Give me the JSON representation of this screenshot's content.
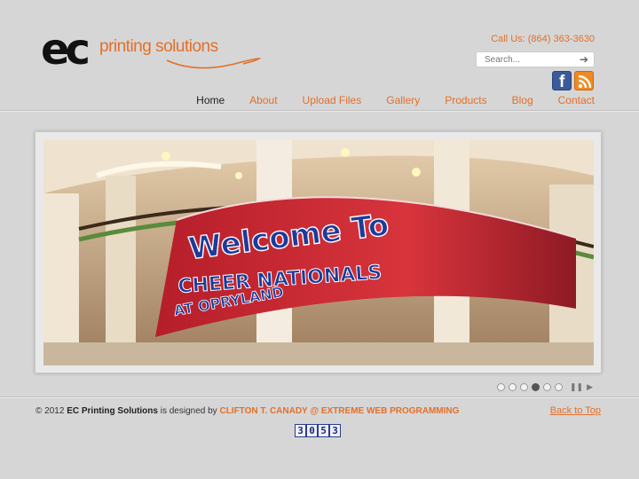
{
  "header": {
    "logo_mark": "ec",
    "logo_text": "printing solutions",
    "phone": "Call Us: (864) 363-3630",
    "search": {
      "placeholder": "Search..."
    },
    "social": [
      {
        "name": "facebook",
        "icon": "facebook-icon",
        "glyph": "f",
        "color": "#3b5a9a"
      },
      {
        "name": "rss",
        "icon": "rss-icon",
        "color": "#f08a20"
      }
    ]
  },
  "nav": {
    "items": [
      {
        "label": "Home",
        "active": true
      },
      {
        "label": "About"
      },
      {
        "label": "Upload Files"
      },
      {
        "label": "Gallery"
      },
      {
        "label": "Products"
      },
      {
        "label": "Blog"
      },
      {
        "label": "Contact"
      }
    ]
  },
  "slider": {
    "banner_line1": "Welcome To",
    "banner_line2": "CHEER NATIONALS",
    "banner_line3": "AT OPRYLAND",
    "dots": 6,
    "active_dot": 4,
    "controls": {
      "pause": "❚❚",
      "play": "▶"
    }
  },
  "footer": {
    "copyright_prefix": "© 2012",
    "company": "EC Printing Solutions",
    "designed_by": "is designed by",
    "designer": "CLIFTON T. CANADY @ EXTREME WEB PROGRAMMING",
    "back_to_top": "Back to Top",
    "counter": [
      "3",
      "0",
      "5",
      "3"
    ]
  },
  "colors": {
    "accent": "#e2702a",
    "background": "#d6d6d6",
    "banner_red": "#c8222e",
    "banner_blue": "#1e3a9a"
  }
}
